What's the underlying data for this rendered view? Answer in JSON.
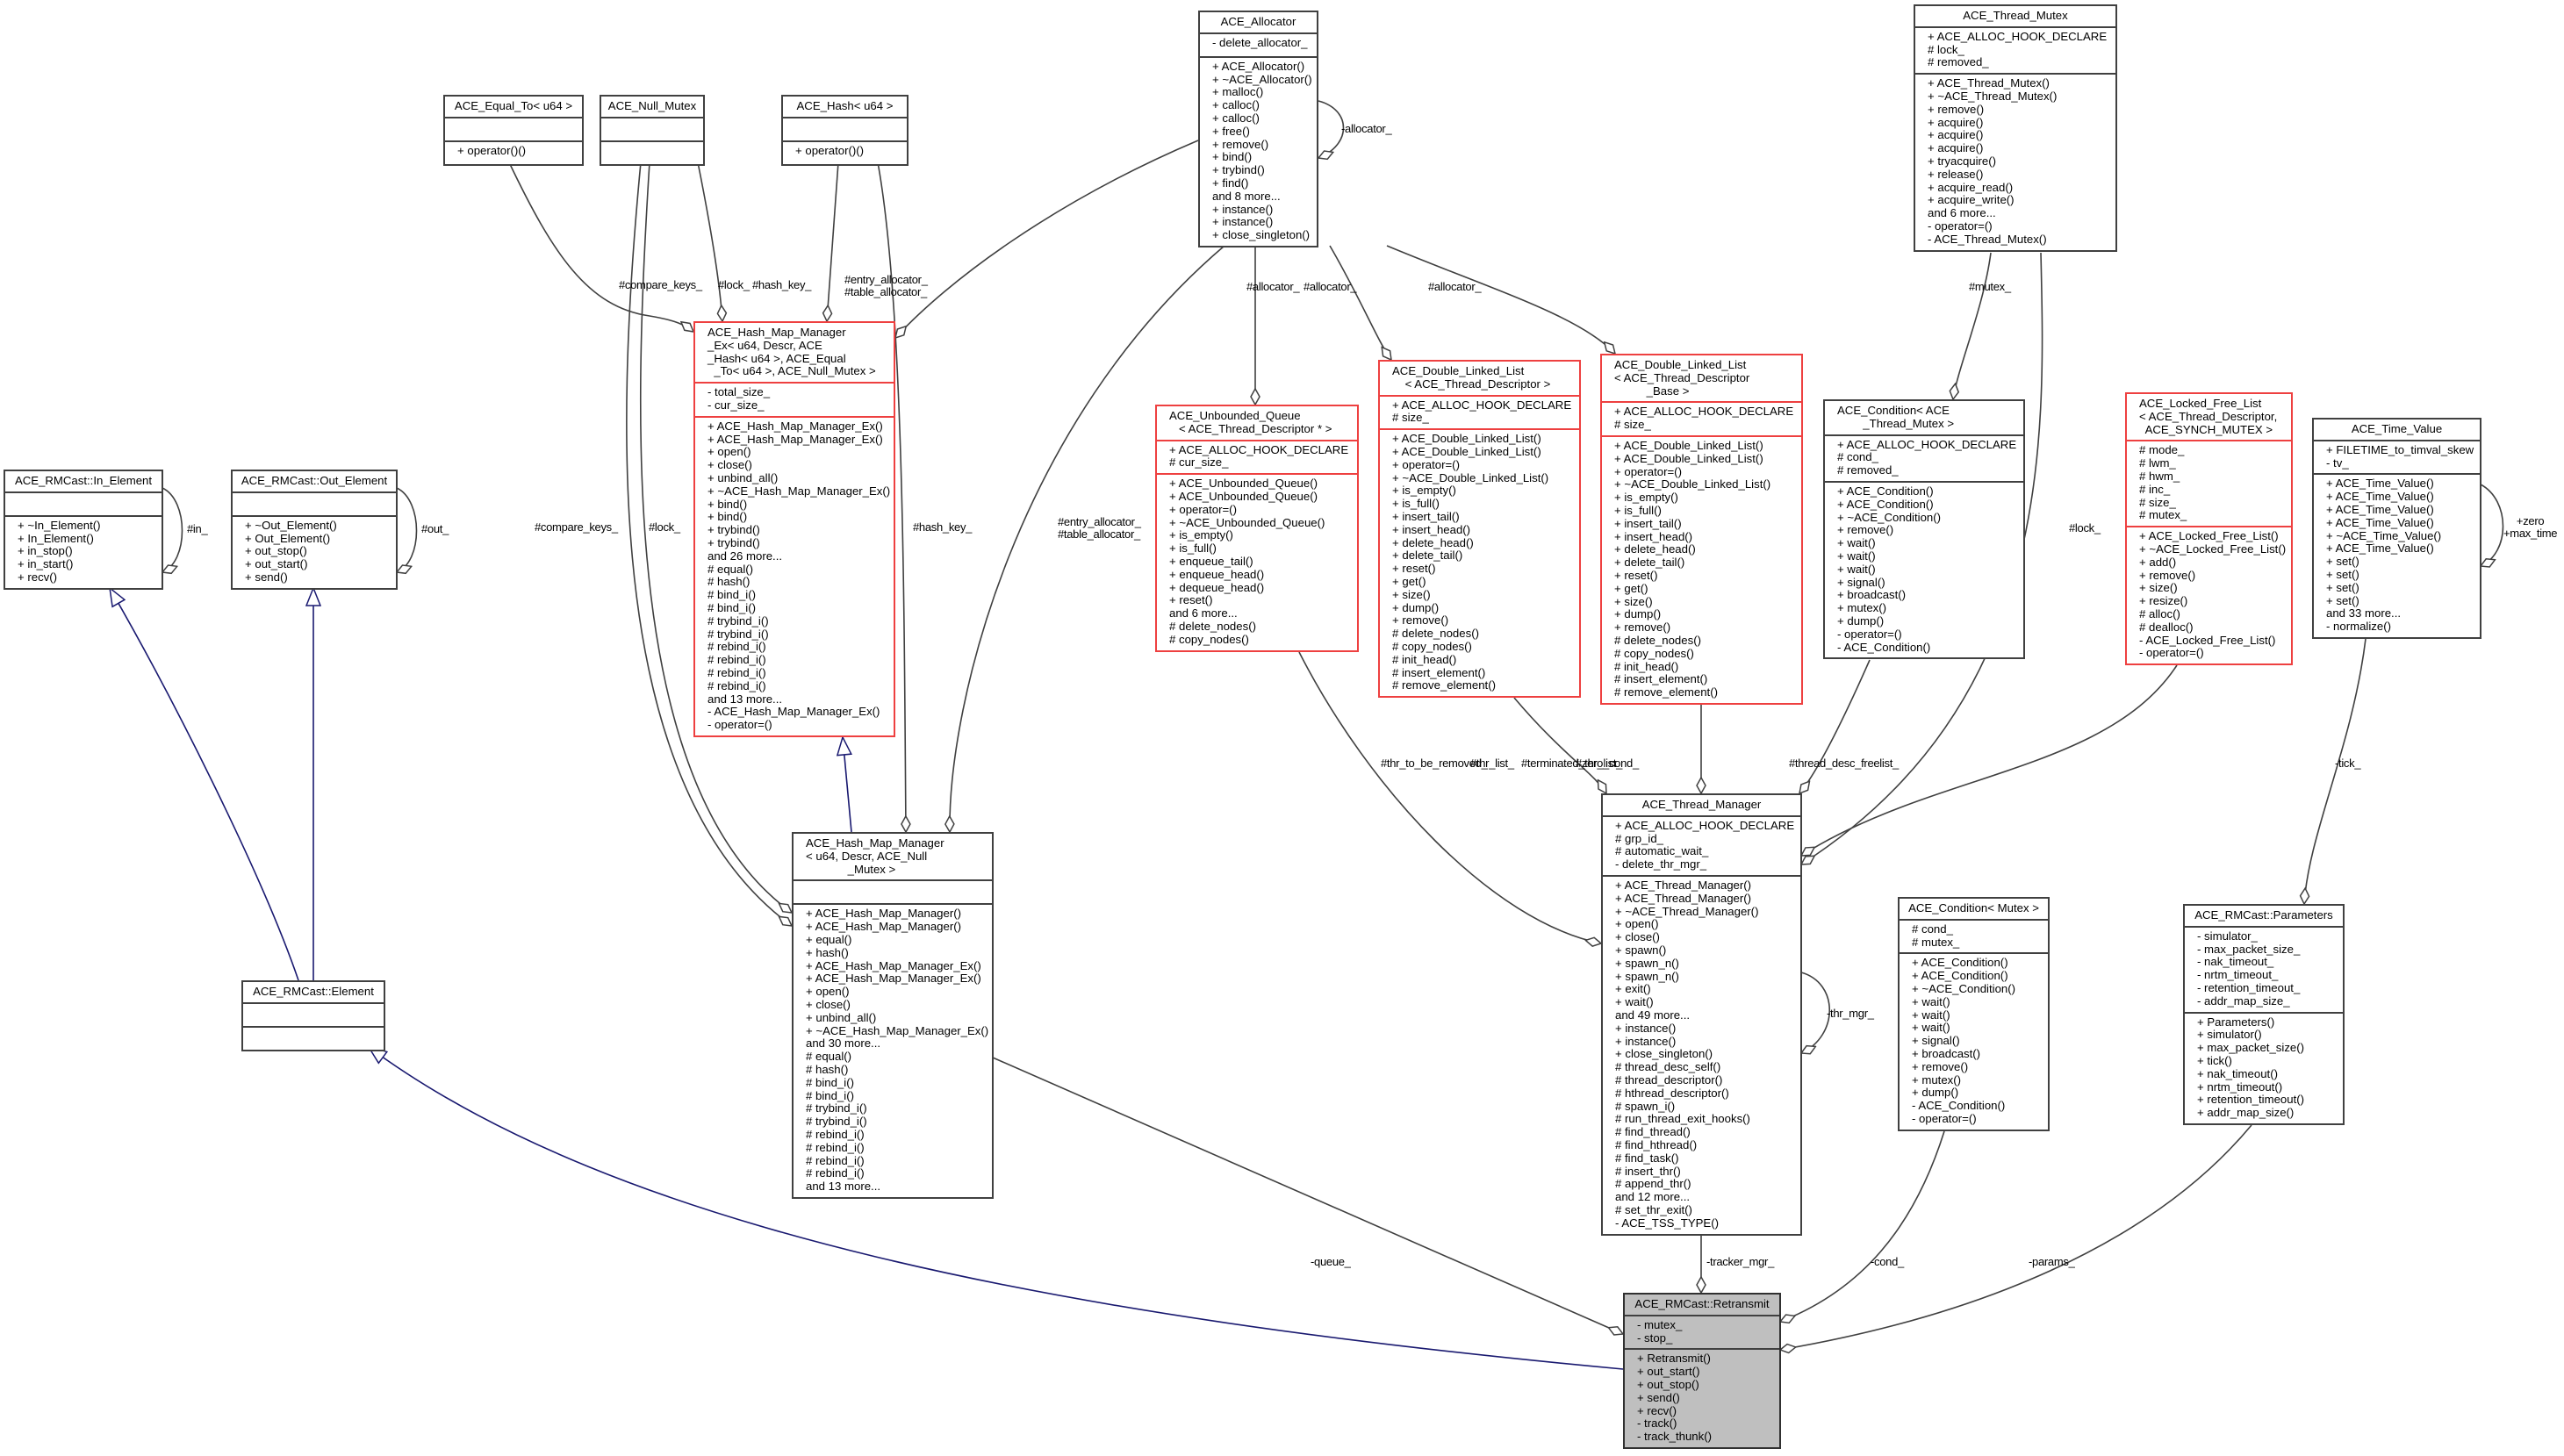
{
  "classes": {
    "allocator": {
      "title": "ACE_Allocator",
      "attributes": [
        "- delete_allocator_"
      ],
      "methods": [
        "+ ACE_Allocator()",
        "+ ~ACE_Allocator()",
        "+ malloc()",
        "+ calloc()",
        "+ calloc()",
        "+ free()",
        "+ remove()",
        "+ bind()",
        "+ trybind()",
        "+ find()",
        "and 8 more...",
        "+ instance()",
        "+ instance()",
        "+ close_singleton()"
      ]
    },
    "thread_mutex": {
      "title": "ACE_Thread_Mutex",
      "attributes": [
        "+ ACE_ALLOC_HOOK_DECLARE",
        "# lock_",
        "# removed_"
      ],
      "methods": [
        "+ ACE_Thread_Mutex()",
        "+ ~ACE_Thread_Mutex()",
        "+ remove()",
        "+ acquire()",
        "+ acquire()",
        "+ acquire()",
        "+ tryacquire()",
        "+ release()",
        "+ acquire_read()",
        "+ acquire_write()",
        "and 6 more...",
        "- operator=()",
        "- ACE_Thread_Mutex()"
      ]
    },
    "equal_to": {
      "title": "ACE_Equal_To< u64 >",
      "attributes": [],
      "methods": [
        "+ operator()()"
      ]
    },
    "null_mutex": {
      "title": "ACE_Null_Mutex",
      "attributes": [],
      "methods": []
    },
    "hash": {
      "title": "ACE_Hash< u64 >",
      "attributes": [],
      "methods": [
        "+ operator()()"
      ]
    },
    "hash_map_manager_ex": {
      "title": "ACE_Hash_Map_Manager\n_Ex< u64, Descr, ACE\n_Hash< u64 >, ACE_Equal\n  _To< u64 >, ACE_Null_Mutex >",
      "attributes": [
        "- total_size_",
        "- cur_size_"
      ],
      "methods": [
        "+ ACE_Hash_Map_Manager_Ex()",
        "+ ACE_Hash_Map_Manager_Ex()",
        "+ open()",
        "+ close()",
        "+ unbind_all()",
        "+ ~ACE_Hash_Map_Manager_Ex()",
        "+ bind()",
        "+ bind()",
        "+ trybind()",
        "+ trybind()",
        "and 26 more...",
        "# equal()",
        "# hash()",
        "# bind_i()",
        "# bind_i()",
        "# trybind_i()",
        "# trybind_i()",
        "# rebind_i()",
        "# rebind_i()",
        "# rebind_i()",
        "# rebind_i()",
        "and 13 more...",
        "- ACE_Hash_Map_Manager_Ex()",
        "- operator=()"
      ]
    },
    "hash_map_manager": {
      "title": "ACE_Hash_Map_Manager\n< u64, Descr, ACE_Null\n             _Mutex >",
      "attributes": [],
      "methods": [
        "+ ACE_Hash_Map_Manager()",
        "+ ACE_Hash_Map_Manager()",
        "+ equal()",
        "+ hash()",
        "+ ACE_Hash_Map_Manager_Ex()",
        "+ ACE_Hash_Map_Manager_Ex()",
        "+ open()",
        "+ close()",
        "+ unbind_all()",
        "+ ~ACE_Hash_Map_Manager_Ex()",
        "and 30 more...",
        "# equal()",
        "# hash()",
        "# bind_i()",
        "# bind_i()",
        "# trybind_i()",
        "# trybind_i()",
        "# rebind_i()",
        "# rebind_i()",
        "# rebind_i()",
        "# rebind_i()",
        "and 13 more..."
      ]
    },
    "unbounded_queue": {
      "title": "ACE_Unbounded_Queue\n   < ACE_Thread_Descriptor * >",
      "attributes": [
        "+ ACE_ALLOC_HOOK_DECLARE",
        "# cur_size_"
      ],
      "methods": [
        "+ ACE_Unbounded_Queue()",
        "+ ACE_Unbounded_Queue()",
        "+ operator=()",
        "+ ~ACE_Unbounded_Queue()",
        "+ is_empty()",
        "+ is_full()",
        "+ enqueue_tail()",
        "+ enqueue_head()",
        "+ dequeue_head()",
        "+ reset()",
        "and 6 more...",
        "# delete_nodes()",
        "# copy_nodes()"
      ]
    },
    "dll_thread_descriptor": {
      "title": "ACE_Double_Linked_List\n    < ACE_Thread_Descriptor >",
      "attributes": [
        "+ ACE_ALLOC_HOOK_DECLARE",
        "# size_"
      ],
      "methods": [
        "+ ACE_Double_Linked_List()",
        "+ ACE_Double_Linked_List()",
        "+ operator=()",
        "+ ~ACE_Double_Linked_List()",
        "+ is_empty()",
        "+ is_full()",
        "+ insert_tail()",
        "+ insert_head()",
        "+ delete_head()",
        "+ delete_tail()",
        "+ reset()",
        "+ get()",
        "+ size()",
        "+ dump()",
        "+ remove()",
        "# delete_nodes()",
        "# copy_nodes()",
        "# init_head()",
        "# insert_element()",
        "# remove_element()"
      ]
    },
    "dll_thread_descriptor_base": {
      "title": "ACE_Double_Linked_List\n< ACE_Thread_Descriptor\n          _Base >",
      "attributes": [
        "+ ACE_ALLOC_HOOK_DECLARE",
        "# size_"
      ],
      "methods": [
        "+ ACE_Double_Linked_List()",
        "+ ACE_Double_Linked_List()",
        "+ operator=()",
        "+ ~ACE_Double_Linked_List()",
        "+ is_empty()",
        "+ is_full()",
        "+ insert_tail()",
        "+ insert_head()",
        "+ delete_head()",
        "+ delete_tail()",
        "+ reset()",
        "+ get()",
        "+ size()",
        "+ dump()",
        "+ remove()",
        "# delete_nodes()",
        "# copy_nodes()",
        "# init_head()",
        "# insert_element()",
        "# remove_element()"
      ]
    },
    "condition_thread_mutex": {
      "title": "ACE_Condition< ACE\n        _Thread_Mutex >",
      "attributes": [
        "+ ACE_ALLOC_HOOK_DECLARE",
        "# cond_",
        "# removed_"
      ],
      "methods": [
        "+ ACE_Condition()",
        "+ ACE_Condition()",
        "+ ~ACE_Condition()",
        "+ remove()",
        "+ wait()",
        "+ wait()",
        "+ wait()",
        "+ signal()",
        "+ broadcast()",
        "+ mutex()",
        "+ dump()",
        "- operator=()",
        "- ACE_Condition()"
      ]
    },
    "locked_free_list": {
      "title": "ACE_Locked_Free_List\n< ACE_Thread_Descriptor,\n  ACE_SYNCH_MUTEX >",
      "attributes": [
        "# mode_",
        "# lwm_",
        "# hwm_",
        "# inc_",
        "# size_",
        "# mutex_"
      ],
      "methods": [
        "+ ACE_Locked_Free_List()",
        "+ ~ACE_Locked_Free_List()",
        "+ add()",
        "+ remove()",
        "+ size()",
        "+ resize()",
        "# alloc()",
        "# dealloc()",
        "- ACE_Locked_Free_List()",
        "- operator=()"
      ]
    },
    "time_value": {
      "title": "ACE_Time_Value",
      "attributes": [
        "+ FILETIME_to_timval_skew",
        "- tv_"
      ],
      "methods": [
        "+ ACE_Time_Value()",
        "+ ACE_Time_Value()",
        "+ ACE_Time_Value()",
        "+ ACE_Time_Value()",
        "+ ~ACE_Time_Value()",
        "+ ACE_Time_Value()",
        "+ set()",
        "+ set()",
        "+ set()",
        "+ set()",
        "and 33 more...",
        "- normalize()"
      ]
    },
    "in_element": {
      "title": "ACE_RMCast::In_Element",
      "attributes": [],
      "methods": [
        "+ ~In_Element()",
        "+ In_Element()",
        "+ in_stop()",
        "+ in_start()",
        "+ recv()"
      ]
    },
    "out_element": {
      "title": "ACE_RMCast::Out_Element",
      "attributes": [],
      "methods": [
        "+ ~Out_Element()",
        "+ Out_Element()",
        "+ out_stop()",
        "+ out_start()",
        "+ send()"
      ]
    },
    "element": {
      "title": "ACE_RMCast::Element",
      "attributes": [],
      "methods": []
    },
    "thread_manager": {
      "title": "ACE_Thread_Manager",
      "attributes": [
        "+ ACE_ALLOC_HOOK_DECLARE",
        "# grp_id_",
        "# automatic_wait_",
        "- delete_thr_mgr_"
      ],
      "methods": [
        "+ ACE_Thread_Manager()",
        "+ ACE_Thread_Manager()",
        "+ ~ACE_Thread_Manager()",
        "+ open()",
        "+ close()",
        "+ spawn()",
        "+ spawn_n()",
        "+ spawn_n()",
        "+ exit()",
        "+ wait()",
        "and 49 more...",
        "+ instance()",
        "+ instance()",
        "+ close_singleton()",
        "# thread_desc_self()",
        "# thread_descriptor()",
        "# hthread_descriptor()",
        "# spawn_i()",
        "# run_thread_exit_hooks()",
        "# find_thread()",
        "# find_hthread()",
        "# find_task()",
        "# insert_thr()",
        "# append_thr()",
        "and 12 more...",
        "# set_thr_exit()",
        "- ACE_TSS_TYPE()"
      ]
    },
    "condition_mutex": {
      "title": "ACE_Condition< Mutex >",
      "attributes": [
        "# cond_",
        "# mutex_"
      ],
      "methods": [
        "+ ACE_Condition()",
        "+ ACE_Condition()",
        "+ ~ACE_Condition()",
        "+ wait()",
        "+ wait()",
        "+ wait()",
        "+ signal()",
        "+ broadcast()",
        "+ remove()",
        "+ mutex()",
        "+ dump()",
        "- ACE_Condition()",
        "- operator=()"
      ]
    },
    "parameters": {
      "title": "ACE_RMCast::Parameters",
      "attributes": [
        "- simulator_",
        "- max_packet_size_",
        "- nak_timeout_",
        "- nrtm_timeout_",
        "- retention_timeout_",
        "- addr_map_size_"
      ],
      "methods": [
        "+ Parameters()",
        "+ simulator()",
        "+ max_packet_size()",
        "+ tick()",
        "+ nak_timeout()",
        "+ nrtm_timeout()",
        "+ retention_timeout()",
        "+ addr_map_size()"
      ]
    },
    "retransmit": {
      "title": "ACE_RMCast::Retransmit",
      "attributes": [
        "- mutex_",
        "- stop_"
      ],
      "methods": [
        "+ Retransmit()",
        "+ out_start()",
        "+ out_stop()",
        "+ send()",
        "+ recv()",
        "- track()",
        "- track_thunk()"
      ]
    }
  },
  "edge_labels": {
    "allocator_self": "-allocator_",
    "in_self": "#in_",
    "out_self": "#out_",
    "time_self": "+zero\n+max_time",
    "thr_mgr_self": "-thr_mgr_",
    "compare_keys_1": "#compare_keys_",
    "lock_1": "#lock_",
    "hash_key_1": "#hash_key_",
    "entry_alloc_1": "#entry_allocator_\n#table_allocator_",
    "compare_keys_2": "#compare_keys_",
    "lock_2": "#lock_",
    "hash_key_2": "#hash_key_",
    "entry_alloc_2": "#entry_allocator_\n#table_allocator_",
    "allocator_q": "#allocator_",
    "allocator_dll1": "#allocator_",
    "allocator_dll2": "#allocator_",
    "mutex_cond": "#mutex_",
    "lock_tm": "#lock_",
    "thr_to_be_removed": "#thr_to_be_removed_",
    "thr_list": "#thr_list_",
    "terminated_thr_list": "#terminated_thr_list_",
    "zero_cond": "#zero_cond_",
    "thread_desc_freelist": "#thread_desc_freelist_",
    "tick": "-tick_",
    "queue": "-queue_",
    "tracker_mgr": "-tracker_mgr_",
    "cond": "-cond_",
    "params": "-params_"
  },
  "colors": {
    "box_border": "#404040",
    "template_border": "#ee4040",
    "focus_fill": "#bfbfbf",
    "inheritance_edge": "#191970",
    "usage_edge": "#404040"
  }
}
